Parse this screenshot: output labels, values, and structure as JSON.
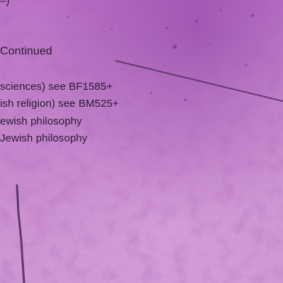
{
  "page": {
    "background_color": "#cc8fd2",
    "text_color": "#2a1b30"
  },
  "lines": [
    "–)",
    "Continued",
    "sciences) see BF1585+",
    "ish religion) see BM525+",
    "ewish philosophy",
    "Jewish philosophy"
  ]
}
